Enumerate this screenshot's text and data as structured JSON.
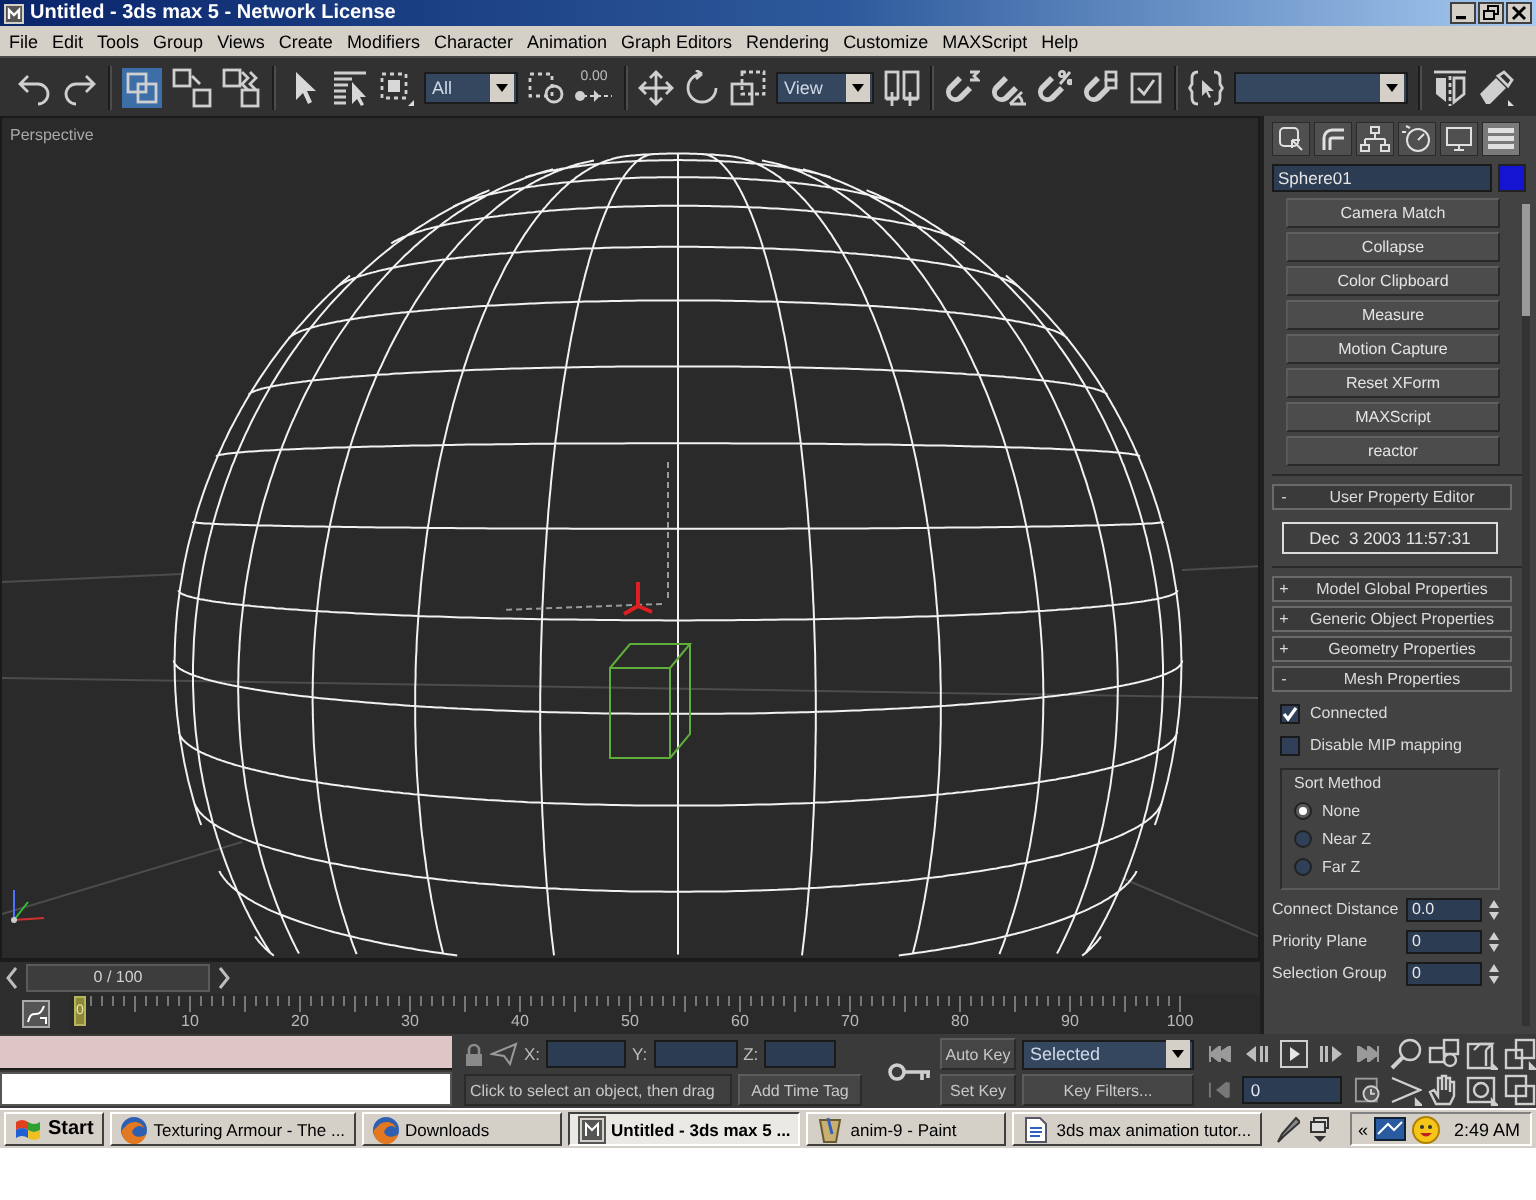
{
  "window": {
    "title": "Untitled - 3ds max 5 - Network License"
  },
  "menu": [
    "File",
    "Edit",
    "Tools",
    "Group",
    "Views",
    "Create",
    "Modifiers",
    "Character",
    "Animation",
    "Graph Editors",
    "Rendering",
    "Customize",
    "MAXScript",
    "Help"
  ],
  "toolbar": {
    "link_tools": [
      {
        "selected": true
      },
      {
        "selected": false
      },
      {
        "selected": false
      }
    ],
    "selection_filter": "All",
    "manipulate_reading": "0.00",
    "coordinate_system": "View"
  },
  "viewport": {
    "label": "Perspective"
  },
  "command_panel": {
    "tabs": [
      {
        "selected": false
      },
      {
        "selected": false
      },
      {
        "selected": false
      },
      {
        "selected": false
      },
      {
        "selected": false
      },
      {
        "selected": true
      }
    ],
    "object_name": "Sphere01",
    "utilities": [
      "Camera Match",
      "Collapse",
      "Color Clipboard",
      "Measure",
      "Motion Capture",
      "Reset XForm",
      "MAXScript",
      "reactor"
    ],
    "user_property_editor": {
      "sign": "-",
      "title": "User Property Editor",
      "date": "Dec  3 2003 11:57:31"
    },
    "rollouts": [
      {
        "sign": "+",
        "title": "Model Global Properties"
      },
      {
        "sign": "+",
        "title": "Generic Object Properties"
      },
      {
        "sign": "+",
        "title": "Geometry Properties"
      },
      {
        "sign": "-",
        "title": "Mesh Properties"
      }
    ],
    "mesh_properties": {
      "checkboxes": [
        {
          "label": "Connected",
          "checked": true
        },
        {
          "label": "Disable MIP mapping",
          "checked": false
        }
      ],
      "sort_method": {
        "title": "Sort Method",
        "options": [
          {
            "label": "None",
            "selected": true
          },
          {
            "label": "Near Z",
            "selected": false
          },
          {
            "label": "Far Z",
            "selected": false
          }
        ]
      },
      "spinners": [
        {
          "label": "Connect Distance",
          "value": "0.0"
        },
        {
          "label": "Priority Plane",
          "value": "0"
        },
        {
          "label": "Selection Group",
          "value": "0"
        }
      ]
    }
  },
  "time_slider": {
    "label": "0 / 100",
    "level": 0
  },
  "track_bar": {
    "marker": "0",
    "ticks": [
      "10",
      "20",
      "30",
      "40",
      "50",
      "60",
      "70",
      "80",
      "90",
      "100"
    ]
  },
  "status": {
    "coordinate_labels": [
      "X:",
      "Y:",
      "Z:"
    ],
    "prompt": "Click to select an object, then drag",
    "time_tag_button": "Add Time Tag"
  },
  "animation_controls": {
    "auto_key": "Auto Key",
    "key_set": "Selected",
    "set_key": "Set Key",
    "key_filters": "Key Filters...",
    "frame": "0"
  },
  "taskbar": {
    "start": "Start",
    "buttons": [
      {
        "label": "Texturing Armour - The ...",
        "selected": false
      },
      {
        "label": "Downloads",
        "selected": false
      },
      {
        "label": "Untitled - 3ds max 5 ...",
        "selected": true
      },
      {
        "label": "anim-9 - Paint",
        "selected": false
      },
      {
        "label": "3ds max animation tutor...",
        "selected": false
      }
    ],
    "tray_expand": "«",
    "clock": "2:49 AM"
  }
}
